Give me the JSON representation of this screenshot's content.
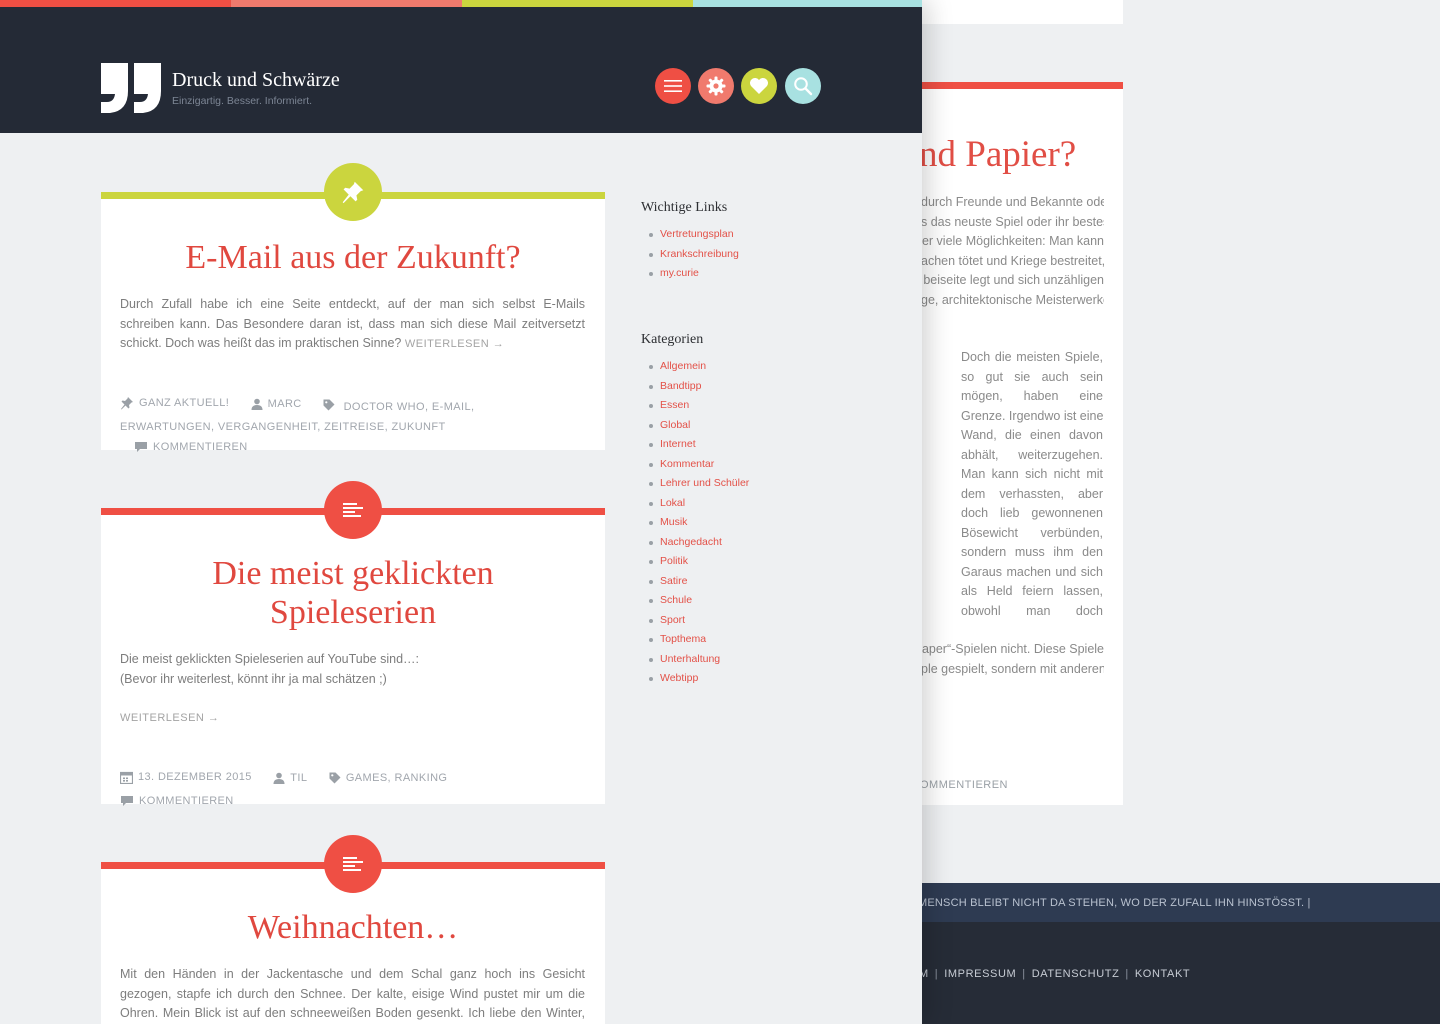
{
  "site": {
    "title": "Druck und Schwärze",
    "tagline": "Einzigartig. Besser. Informiert."
  },
  "colors": {
    "header_bg": "#242a36",
    "stripe": [
      "#ef4f44",
      "#f07a6d",
      "#cbd53e",
      "#a8e1e1"
    ],
    "accent_red": "#ef4f44",
    "accent_lime": "#cbd53e",
    "page_bg": "#eef0f2"
  },
  "header_buttons": [
    {
      "icon": "menu-icon",
      "color": "#ef4f44"
    },
    {
      "icon": "gear-icon",
      "color": "#f07a6d"
    },
    {
      "icon": "heart-icon",
      "color": "#cbd53e"
    },
    {
      "icon": "search-icon",
      "color": "#a8e1e1"
    }
  ],
  "posts": [
    {
      "badge_icon": "pin-icon",
      "badge_color": "#cbd53e",
      "title": "E-Mail aus der Zukunft?",
      "excerpt": "Durch Zufall habe ich eine Seite entdeckt, auf der man sich selbst E-Mails schreiben kann. Das Besondere daran ist, dass man sich diese Mail zeitversetzt schickt. Doch was heißt das im praktischen Sinne?",
      "more": "Weiterlesen →",
      "meta": {
        "sticky": "Ganz aktuell!",
        "author": "Marc",
        "tags": "Doctor Who, E-Mail, Erwartungen, Vergangenheit, Zeitreise, Zukunft",
        "comments": "Kommentieren"
      }
    },
    {
      "badge_icon": "text-format-icon",
      "badge_color": "#ef4f44",
      "title_line1": "Die meist geklickten",
      "title_line2": "Spieleserien",
      "excerpt_line1": "Die meist geklickten Spieleserien auf YouTube sind…:",
      "excerpt_line2": "(Bevor ihr weiterlest, könnt ihr ja mal schätzen ;)",
      "more": "Weiterlesen →",
      "meta": {
        "date": "13. Dezember 2015",
        "author": "Til",
        "tags": "Games, Ranking",
        "comments": "Kommentieren"
      }
    },
    {
      "badge_icon": "text-format-icon",
      "badge_color": "#ef4f44",
      "title": "Weihnachten…",
      "excerpt": "Mit den Händen in der Jackentasche und dem Schal ganz hoch ins Gesicht gezogen, stapfe ich durch den Schnee. Der kalte, eisige Wind pustet mir um die Ohren. Mein Blick ist auf den schneeweißen Boden gesenkt. Ich liebe den Winter, auch wenn viele das als"
    }
  ],
  "sidebar": {
    "links_title": "Wichtige Links",
    "links": [
      "Vertretungsplan",
      "Krankschreibung",
      "my.curie"
    ],
    "categories_title": "Kategorien",
    "categories": [
      "Allgemein",
      "Bandtipp",
      "Essen",
      "Global",
      "Internet",
      "Kommentar",
      "Lehrer und Schüler",
      "Lokal",
      "Musik",
      "Nachgedacht",
      "Politik",
      "Satire",
      "Schule",
      "Sport",
      "Topthema",
      "Unterhaltung",
      "Webtipp"
    ]
  },
  "background_page": {
    "title": "nd Papier?",
    "para1": [
      "durch Freunde und Bekannte oder",
      "s das neuste Spiel oder ihr bestes",
      "er viele Möglichkeiten: Man kann",
      "achen tötet und Kriege bestreitet,",
      "beiseite legt und sich unzähligen",
      "ge, architektonische Meisterwerke"
    ],
    "para2": [
      "Doch die meisten Spiele,",
      "so gut sie auch sein",
      "mögen, haben eine",
      "Grenze. Irgendwo ist eine",
      "Wand, die einen davon",
      "abhält, weiterzugehen.",
      "Man kann sich nicht mit",
      "dem verhassten, aber",
      "doch lieb gewonnenen",
      "Bösewicht verbünden,",
      "sondern muss ihm den",
      "Garaus machen und sich",
      "als Held feiern lassen,",
      "obwohl man doch"
    ],
    "para3": [
      "aper“-Spielen nicht. Diese Spiele",
      "ple gespielt, sondern mit anderen"
    ],
    "meta": "OMMENTIEREN",
    "quote": "MENSCH BLEIBT NICHT DA STEHEN, WO DER ZUFALL IHN HINSTÖSST.  |",
    "footer": {
      "first": "M",
      "links": [
        "IMPRESSUM",
        "DATENSCHUTZ",
        "KONTAKT"
      ]
    }
  }
}
